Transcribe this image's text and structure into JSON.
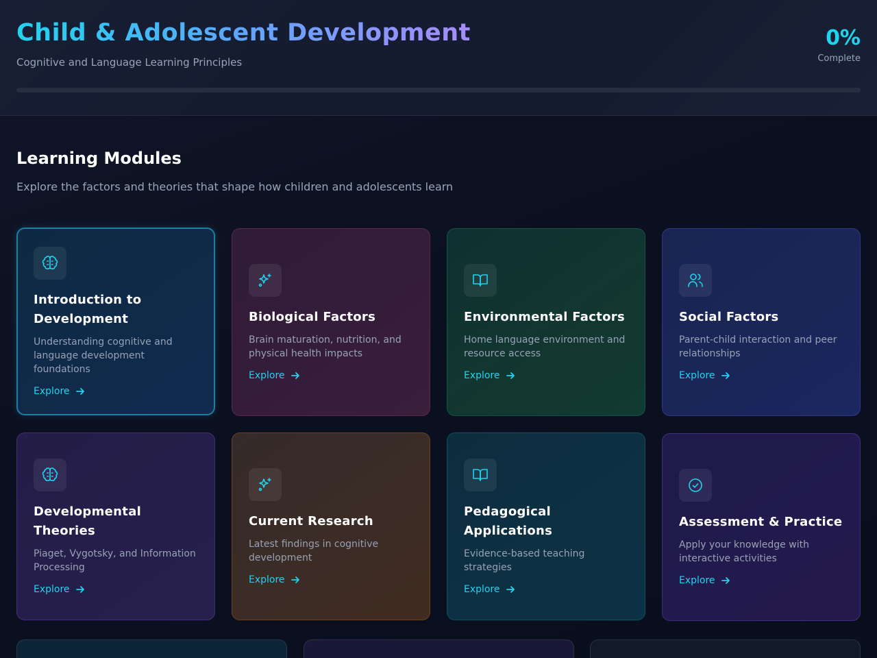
{
  "header": {
    "title": "Child & Adolescent Development",
    "subtitle": "Cognitive and Language Learning Principles",
    "progress_value": "0%",
    "progress_label": "Complete",
    "progress_fraction": 0
  },
  "section": {
    "title": "Learning Modules",
    "subtitle": "Explore the factors and theories that shape how children and adolescents learn"
  },
  "modules": [
    {
      "title_line1": "Introduction to",
      "title_line2": "Development",
      "desc": "Understanding cognitive and language development foundations",
      "link": "Explore",
      "icon": "brain-icon"
    },
    {
      "title_line1": "Biological Factors",
      "title_line2": "",
      "desc": "Brain maturation, nutrition, and physical health impacts",
      "link": "Explore",
      "icon": "sparkles-icon"
    },
    {
      "title_line1": "Environmental Factors",
      "title_line2": "",
      "desc": "Home language environment and resource access",
      "link": "Explore",
      "icon": "book-open-icon"
    },
    {
      "title_line1": "Social Factors",
      "title_line2": "",
      "desc": "Parent-child interaction and peer relationships",
      "link": "Explore",
      "icon": "users-icon"
    },
    {
      "title_line1": "Developmental",
      "title_line2": "Theories",
      "desc": "Piaget, Vygotsky, and Information Processing",
      "link": "Explore",
      "icon": "brain-icon"
    },
    {
      "title_line1": "Current Research",
      "title_line2": "",
      "desc": "Latest findings in cognitive development",
      "link": "Explore",
      "icon": "sparkles-icon"
    },
    {
      "title_line1": "Pedagogical",
      "title_line2": "Applications",
      "desc": "Evidence-based teaching strategies",
      "link": "Explore",
      "icon": "book-open-icon"
    },
    {
      "title_line1": "Assessment & Practice",
      "title_line2": "",
      "desc": "Apply your knowledge with interactive activities",
      "link": "Explore",
      "icon": "check-circle-icon"
    }
  ],
  "colors": {
    "accent": "#22d3ee",
    "title_gradient_start": "#22d3ee",
    "title_gradient_end": "#a78bfa"
  }
}
